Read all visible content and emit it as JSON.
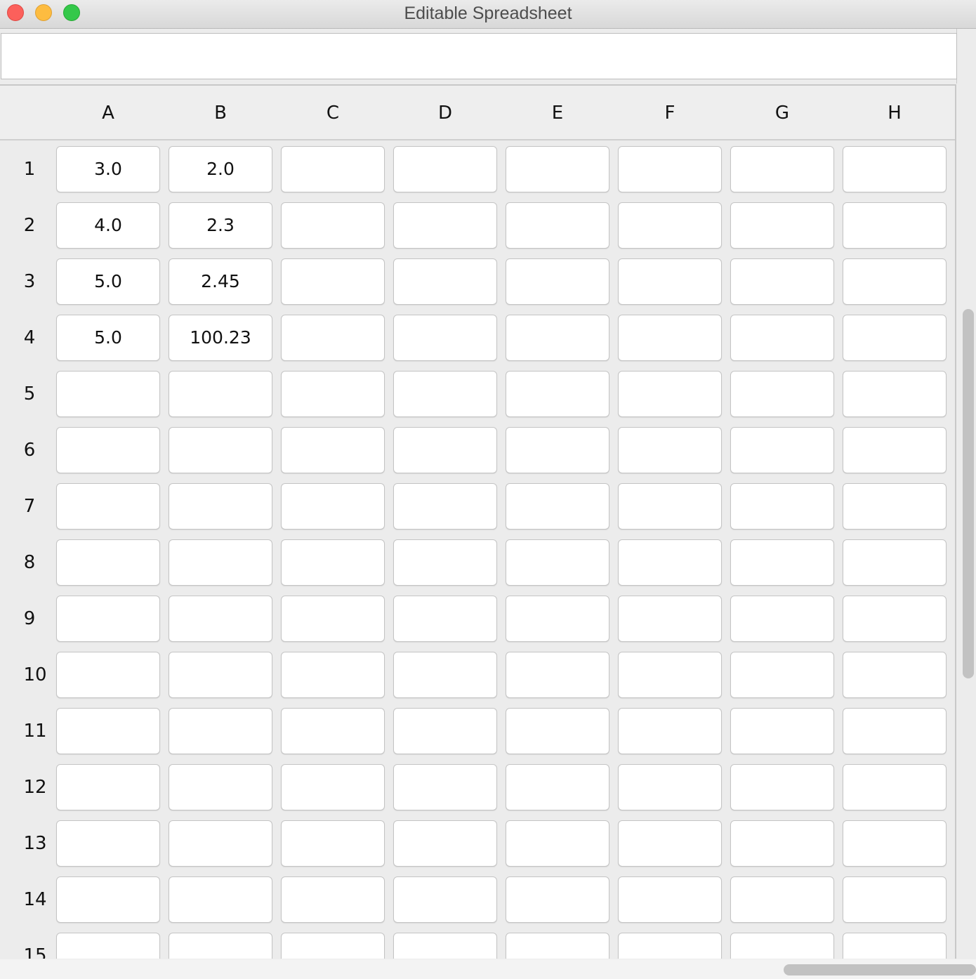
{
  "window": {
    "title": "Editable Spreadsheet"
  },
  "formula_bar": {
    "value": "",
    "placeholder": ""
  },
  "columns": [
    "A",
    "B",
    "C",
    "D",
    "E",
    "F",
    "G",
    "H"
  ],
  "rows": [
    {
      "label": "1",
      "cells": [
        "3.0",
        "2.0",
        "",
        "",
        "",
        "",
        "",
        ""
      ]
    },
    {
      "label": "2",
      "cells": [
        "4.0",
        "2.3",
        "",
        "",
        "",
        "",
        "",
        ""
      ]
    },
    {
      "label": "3",
      "cells": [
        "5.0",
        "2.45",
        "",
        "",
        "",
        "",
        "",
        ""
      ]
    },
    {
      "label": "4",
      "cells": [
        "5.0",
        "100.23",
        "",
        "",
        "",
        "",
        "",
        ""
      ]
    },
    {
      "label": "5",
      "cells": [
        "",
        "",
        "",
        "",
        "",
        "",
        "",
        ""
      ]
    },
    {
      "label": "6",
      "cells": [
        "",
        "",
        "",
        "",
        "",
        "",
        "",
        ""
      ]
    },
    {
      "label": "7",
      "cells": [
        "",
        "",
        "",
        "",
        "",
        "",
        "",
        ""
      ]
    },
    {
      "label": "8",
      "cells": [
        "",
        "",
        "",
        "",
        "",
        "",
        "",
        ""
      ]
    },
    {
      "label": "9",
      "cells": [
        "",
        "",
        "",
        "",
        "",
        "",
        "",
        ""
      ]
    },
    {
      "label": "10",
      "cells": [
        "",
        "",
        "",
        "",
        "",
        "",
        "",
        ""
      ]
    },
    {
      "label": "11",
      "cells": [
        "",
        "",
        "",
        "",
        "",
        "",
        "",
        ""
      ]
    },
    {
      "label": "12",
      "cells": [
        "",
        "",
        "",
        "",
        "",
        "",
        "",
        ""
      ]
    },
    {
      "label": "13",
      "cells": [
        "",
        "",
        "",
        "",
        "",
        "",
        "",
        ""
      ]
    },
    {
      "label": "14",
      "cells": [
        "",
        "",
        "",
        "",
        "",
        "",
        "",
        ""
      ]
    },
    {
      "label": "15",
      "cells": [
        "",
        "",
        "",
        "",
        "",
        "",
        "",
        ""
      ]
    }
  ]
}
